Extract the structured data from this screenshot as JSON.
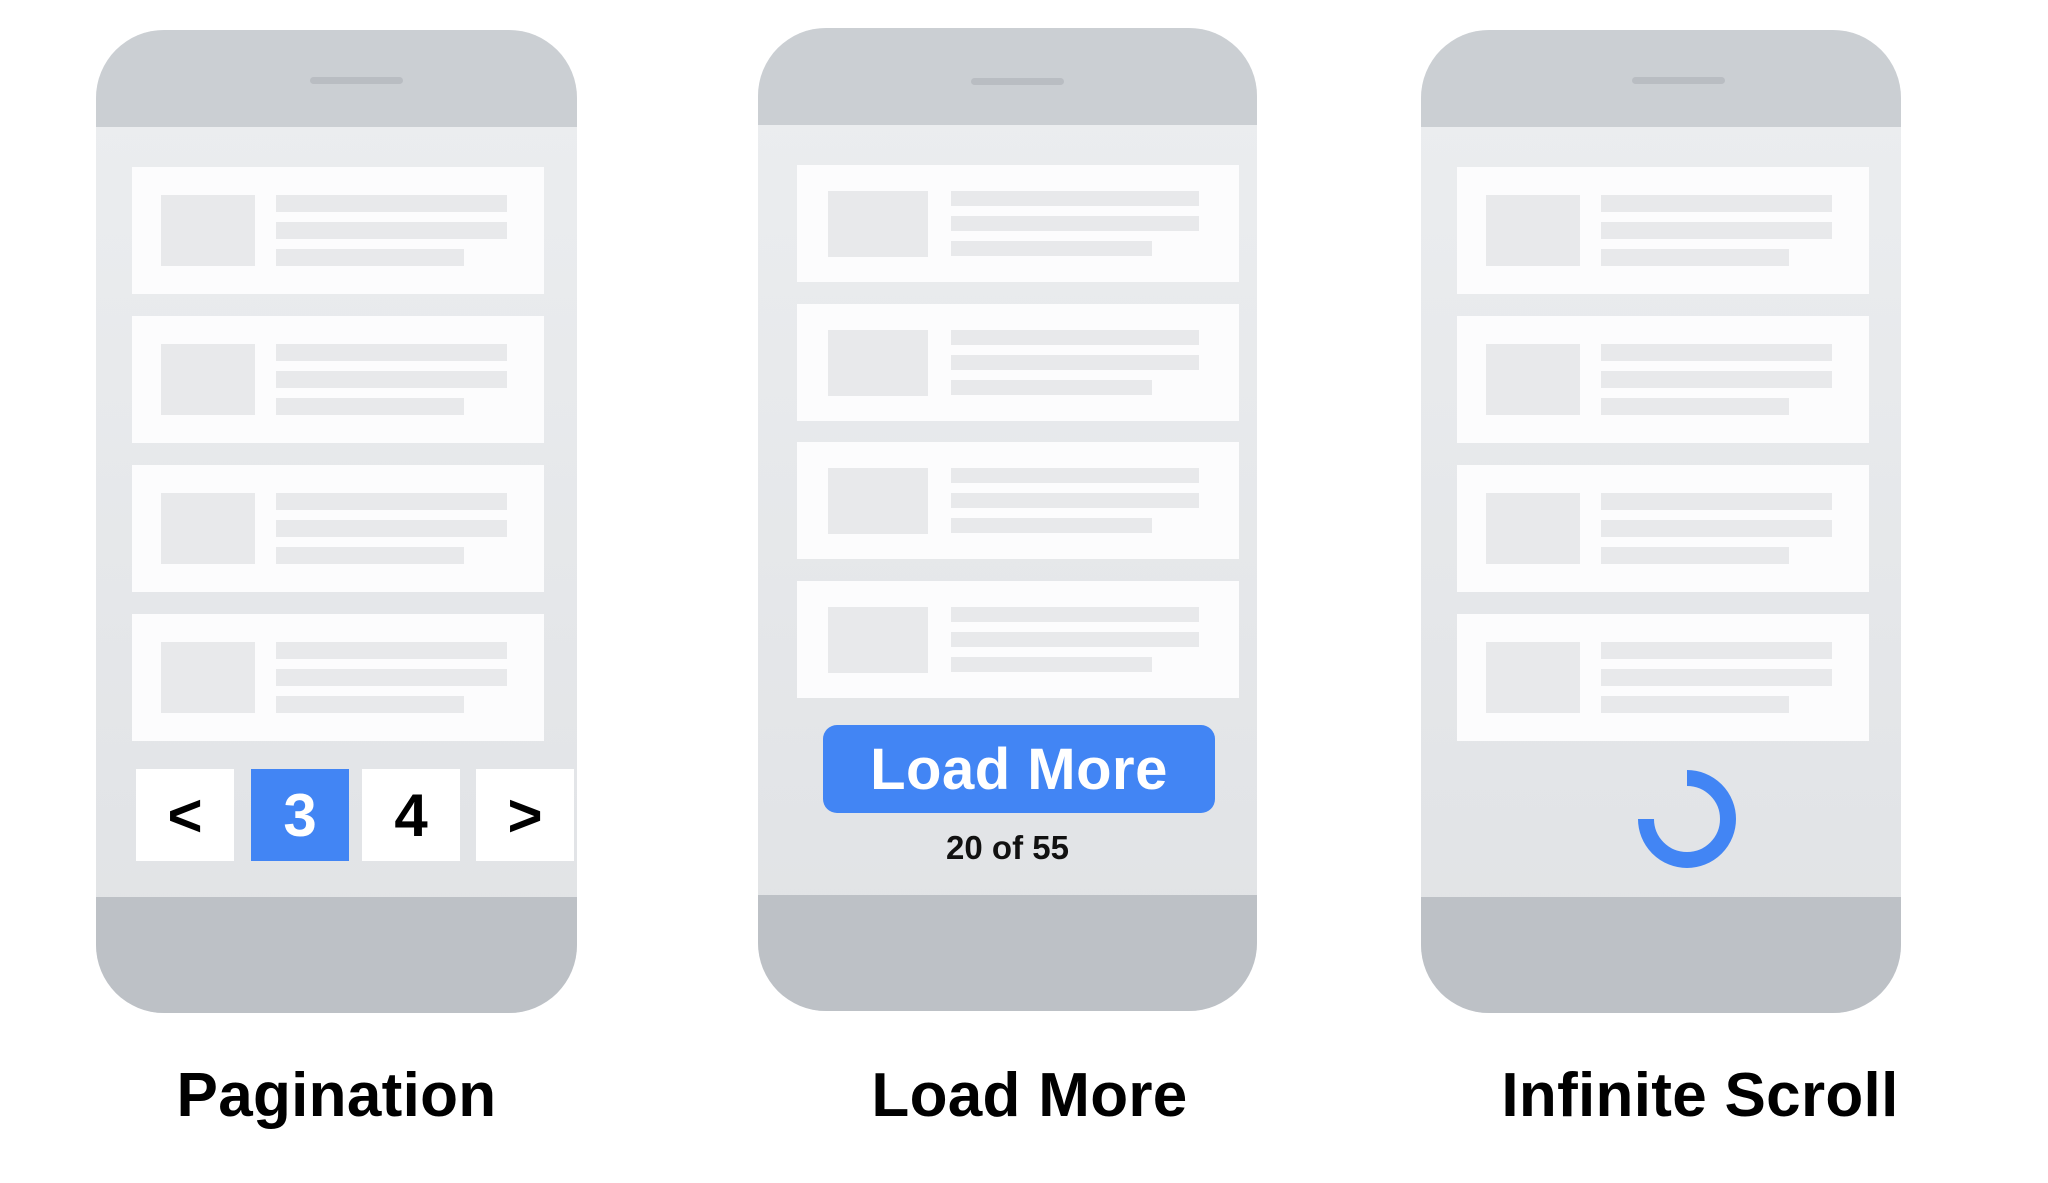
{
  "colors": {
    "accent": "#4285F4",
    "bezel_top": "#CBCFD3",
    "bezel_bottom": "#BDC1C6",
    "screen": "#E6E8EA",
    "card": "#FCFCFD",
    "placeholder": "#E8E9EB"
  },
  "phones": [
    {
      "label": "Pagination",
      "pagination": {
        "prev_icon": "chevron-left",
        "prev_label": "<",
        "pages": [
          {
            "label": "3",
            "active": true
          },
          {
            "label": "4",
            "active": false
          }
        ],
        "next_icon": "chevron-right",
        "next_label": ">"
      }
    },
    {
      "label": "Load More",
      "load_more": {
        "button_label": "Load More",
        "count_text": "20 of 55"
      }
    },
    {
      "label": "Infinite Scroll",
      "spinner": {
        "icon": "loading-spinner"
      }
    }
  ]
}
